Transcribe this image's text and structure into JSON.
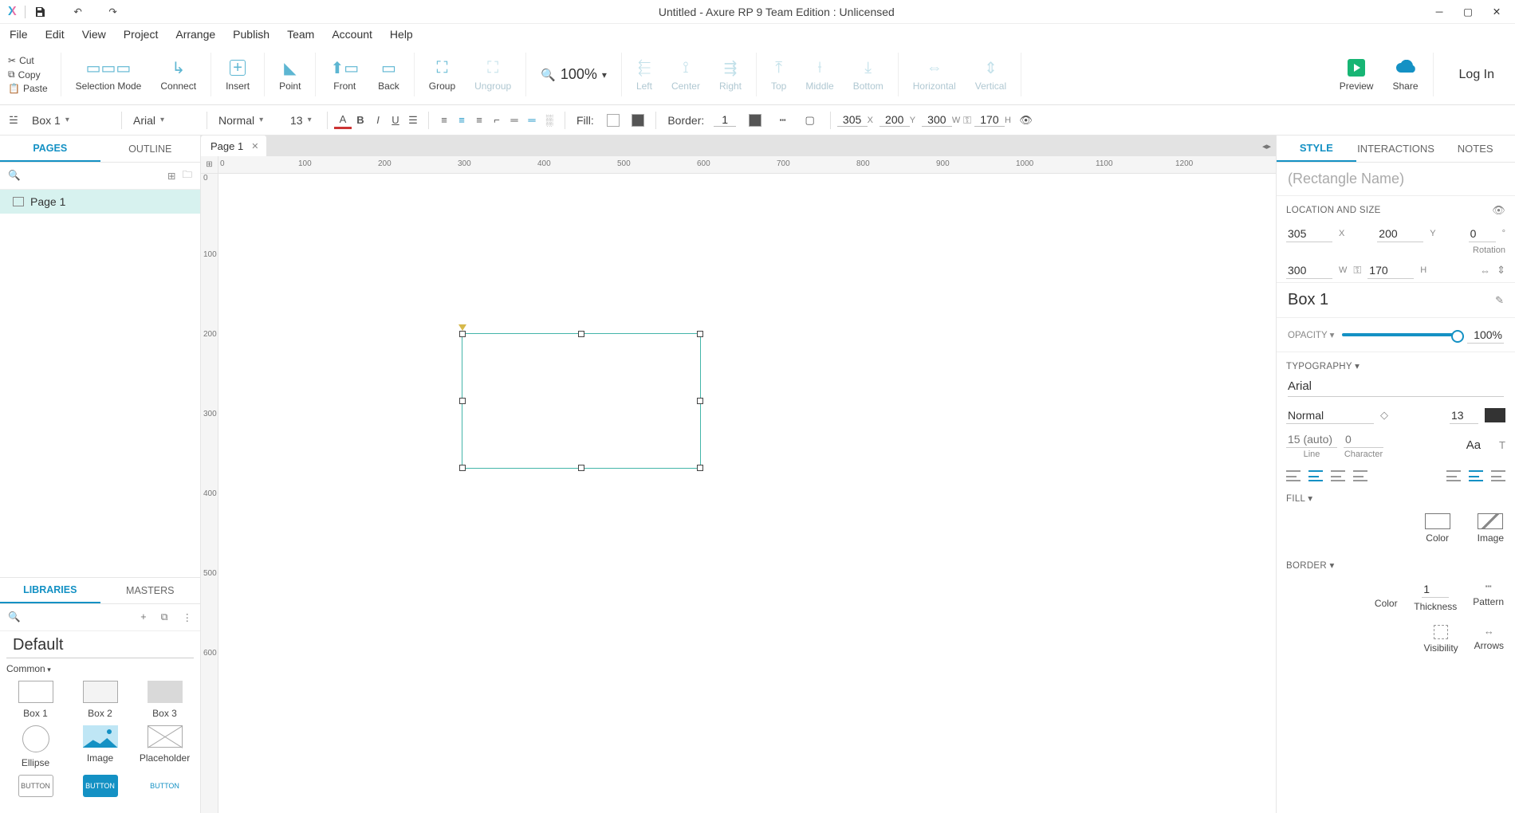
{
  "titlebar": {
    "title": "Untitled - Axure RP 9 Team Edition : Unlicensed"
  },
  "menu": [
    "File",
    "Edit",
    "View",
    "Project",
    "Arrange",
    "Publish",
    "Team",
    "Account",
    "Help"
  ],
  "clip": {
    "cut": "Cut",
    "copy": "Copy",
    "paste": "Paste"
  },
  "tools": {
    "selection": "Selection Mode",
    "connect": "Connect",
    "insert": "Insert",
    "point": "Point",
    "front": "Front",
    "back": "Back",
    "group": "Group",
    "ungroup": "Ungroup",
    "left": "Left",
    "center": "Center",
    "right": "Right",
    "top": "Top",
    "middle": "Middle",
    "bottom": "Bottom",
    "horizontal": "Horizontal",
    "vertical": "Vertical",
    "preview": "Preview",
    "share": "Share",
    "login": "Log In",
    "zoom": "100%"
  },
  "fmt": {
    "widget": "Box 1",
    "font": "Arial",
    "weight": "Normal",
    "size": "13",
    "fill": "Fill:",
    "border": "Border:",
    "bw": "1",
    "x": "305",
    "y": "200",
    "w": "300",
    "h": "170",
    "xl": "X",
    "yl": "Y",
    "wl": "W",
    "hl": "H"
  },
  "left": {
    "tabs": {
      "pages": "PAGES",
      "outline": "OUTLINE"
    },
    "page": "Page 1",
    "libtabs": {
      "libraries": "LIBRARIES",
      "masters": "MASTERS"
    },
    "libtitle": "Default",
    "libsec": "Common",
    "shapes": {
      "box1": "Box 1",
      "box2": "Box 2",
      "box3": "Box 3",
      "ellipse": "Ellipse",
      "image": "Image",
      "placeholder": "Placeholder",
      "btn": "BUTTON"
    }
  },
  "canvas": {
    "tab": "Page 1",
    "origin": "0",
    "hticks": [
      "0",
      "100",
      "200",
      "300",
      "400",
      "500",
      "600",
      "700",
      "800",
      "900",
      "1000",
      "1100",
      "1200"
    ],
    "vticks": [
      "0",
      "100",
      "200",
      "300",
      "400",
      "500",
      "600"
    ]
  },
  "right": {
    "tabs": {
      "style": "STYLE",
      "interactions": "INTERACTIONS",
      "notes": "NOTES"
    },
    "nameplaceholder": "(Rectangle Name)",
    "loc": "LOCATION AND SIZE",
    "x": "305",
    "y": "200",
    "rot": "0",
    "rotl": "Rotation",
    "deg": "°",
    "w": "300",
    "h": "170",
    "xl": "X",
    "yl": "Y",
    "wl": "W",
    "hl": "H",
    "widget": "Box 1",
    "opacity": "OPACITY",
    "oval": "100%",
    "typo": "TYPOGRAPHY",
    "font": "Arial",
    "weight": "Normal",
    "size": "13",
    "lineph": "15 (auto)",
    "charph": "0",
    "line": "Line",
    "char": "Character",
    "aa": "Aa",
    "fill": "FILL",
    "color": "Color",
    "image": "Image",
    "border": "BORDER",
    "thick": "1",
    "thickl": "Thickness",
    "pattern": "Pattern",
    "vis": "Visibility",
    "arrows": "Arrows"
  }
}
